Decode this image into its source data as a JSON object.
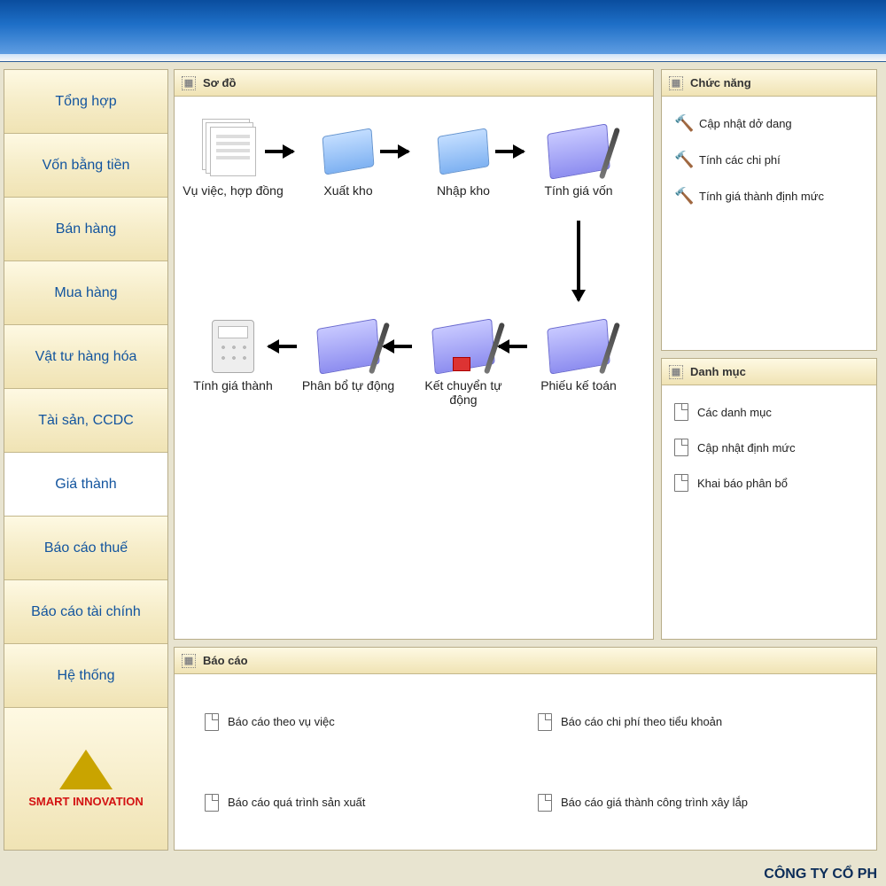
{
  "sidebar": {
    "items": [
      {
        "label": "Tổng hợp"
      },
      {
        "label": "Vốn bằng tiền"
      },
      {
        "label": "Bán hàng"
      },
      {
        "label": "Mua hàng"
      },
      {
        "label": "Vật tư hàng hóa"
      },
      {
        "label": "Tài sản, CCDC"
      },
      {
        "label": "Giá thành"
      },
      {
        "label": "Báo cáo thuế"
      },
      {
        "label": "Báo cáo tài chính"
      },
      {
        "label": "Hệ thống"
      }
    ],
    "active_index": 6,
    "logo_text": "SMART INNOVATION"
  },
  "diagram": {
    "title": "Sơ đồ",
    "nodes": {
      "n1": "Vụ việc, hợp đồng",
      "n2": "Xuất kho",
      "n3": "Nhập kho",
      "n4": "Tính giá vốn",
      "n5": "Phiếu kế toán",
      "n6": "Kết chuyển tự động",
      "n7": "Phân bổ tự động",
      "n8": "Tính giá thành"
    }
  },
  "functions": {
    "title": "Chức năng",
    "items": [
      {
        "label": "Cập nhật dở dang"
      },
      {
        "label": "Tính các chi phí"
      },
      {
        "label": "Tính giá thành định mức"
      }
    ]
  },
  "categories": {
    "title": "Danh mục",
    "items": [
      {
        "label": "Các danh mục"
      },
      {
        "label": "Cập nhật định mức"
      },
      {
        "label": "Khai báo phân bổ"
      }
    ]
  },
  "reports": {
    "title": "Báo cáo",
    "items": [
      {
        "label": "Báo cáo theo vụ việc"
      },
      {
        "label": "Báo cáo chi phí theo tiểu khoản"
      },
      {
        "label": "Báo cáo quá trình sản xuất"
      },
      {
        "label": "Báo cáo giá thành công trình xây lắp"
      }
    ]
  },
  "footer": "CÔNG TY CỔ PH"
}
